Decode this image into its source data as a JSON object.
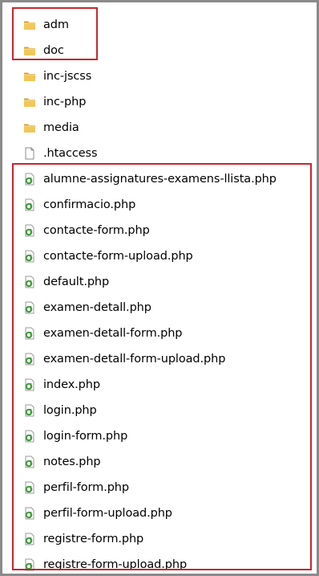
{
  "items": [
    {
      "name": "adm",
      "type": "folder"
    },
    {
      "name": "doc",
      "type": "folder"
    },
    {
      "name": "inc-jscss",
      "type": "folder"
    },
    {
      "name": "inc-php",
      "type": "folder"
    },
    {
      "name": "media",
      "type": "folder"
    },
    {
      "name": ".htaccess",
      "type": "file"
    },
    {
      "name": "alumne-assignatures-examens-llista.php",
      "type": "php"
    },
    {
      "name": "confirmacio.php",
      "type": "php"
    },
    {
      "name": "contacte-form.php",
      "type": "php"
    },
    {
      "name": "contacte-form-upload.php",
      "type": "php"
    },
    {
      "name": "default.php",
      "type": "php"
    },
    {
      "name": "examen-detall.php",
      "type": "php"
    },
    {
      "name": "examen-detall-form.php",
      "type": "php"
    },
    {
      "name": "examen-detall-form-upload.php",
      "type": "php"
    },
    {
      "name": "index.php",
      "type": "php"
    },
    {
      "name": "login.php",
      "type": "php"
    },
    {
      "name": "login-form.php",
      "type": "php"
    },
    {
      "name": "notes.php",
      "type": "php"
    },
    {
      "name": "perfil-form.php",
      "type": "php"
    },
    {
      "name": "perfil-form-upload.php",
      "type": "php"
    },
    {
      "name": "registre-form.php",
      "type": "php"
    },
    {
      "name": "registre-form-upload.php",
      "type": "php"
    }
  ],
  "colors": {
    "highlight_border": "#c8262e",
    "folder": "#e8b53a",
    "php_icon": "#3f9a3b"
  }
}
